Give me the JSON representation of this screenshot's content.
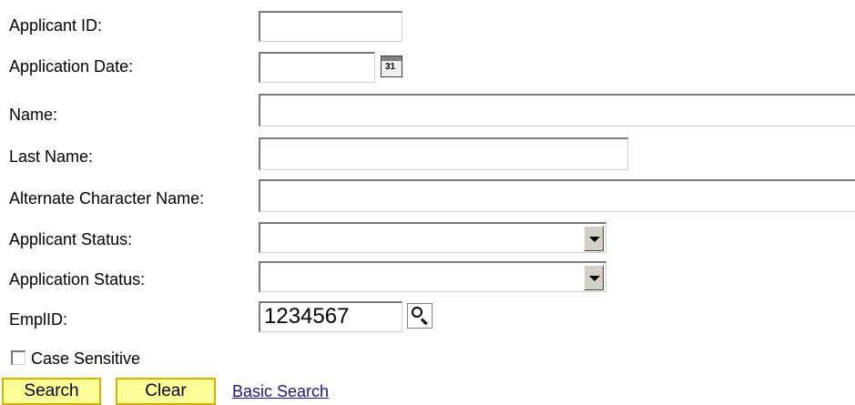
{
  "form": {
    "applicant_id_label": "Applicant ID:",
    "application_date_label": "Application Date:",
    "name_label": "Name:",
    "last_name_label": "Last Name:",
    "alt_char_name_label": "Alternate Character Name:",
    "applicant_status_label": "Applicant Status:",
    "application_status_label": "Application Status:",
    "emplid_label": "EmplID:",
    "emplid_value": "1234567",
    "applicant_id_value": "",
    "application_date_value": "",
    "name_value": "",
    "last_name_value": "",
    "alt_char_name_value": "",
    "applicant_status_value": "",
    "application_status_value": "",
    "case_sensitive_label": "Case Sensitive",
    "case_sensitive_checked": false,
    "calendar_icon_text": "31"
  },
  "actions": {
    "search_label": "Search",
    "clear_label": "Clear",
    "basic_search_label": "Basic Search"
  },
  "icons": {
    "calendar": "calendar-icon",
    "lookup": "lookup-magnifier-icon",
    "dropdown": "chevron-down-icon"
  },
  "colors": {
    "button_bg": "#ffff99",
    "button_border": "#d4b200",
    "link": "#1a1a7a"
  }
}
